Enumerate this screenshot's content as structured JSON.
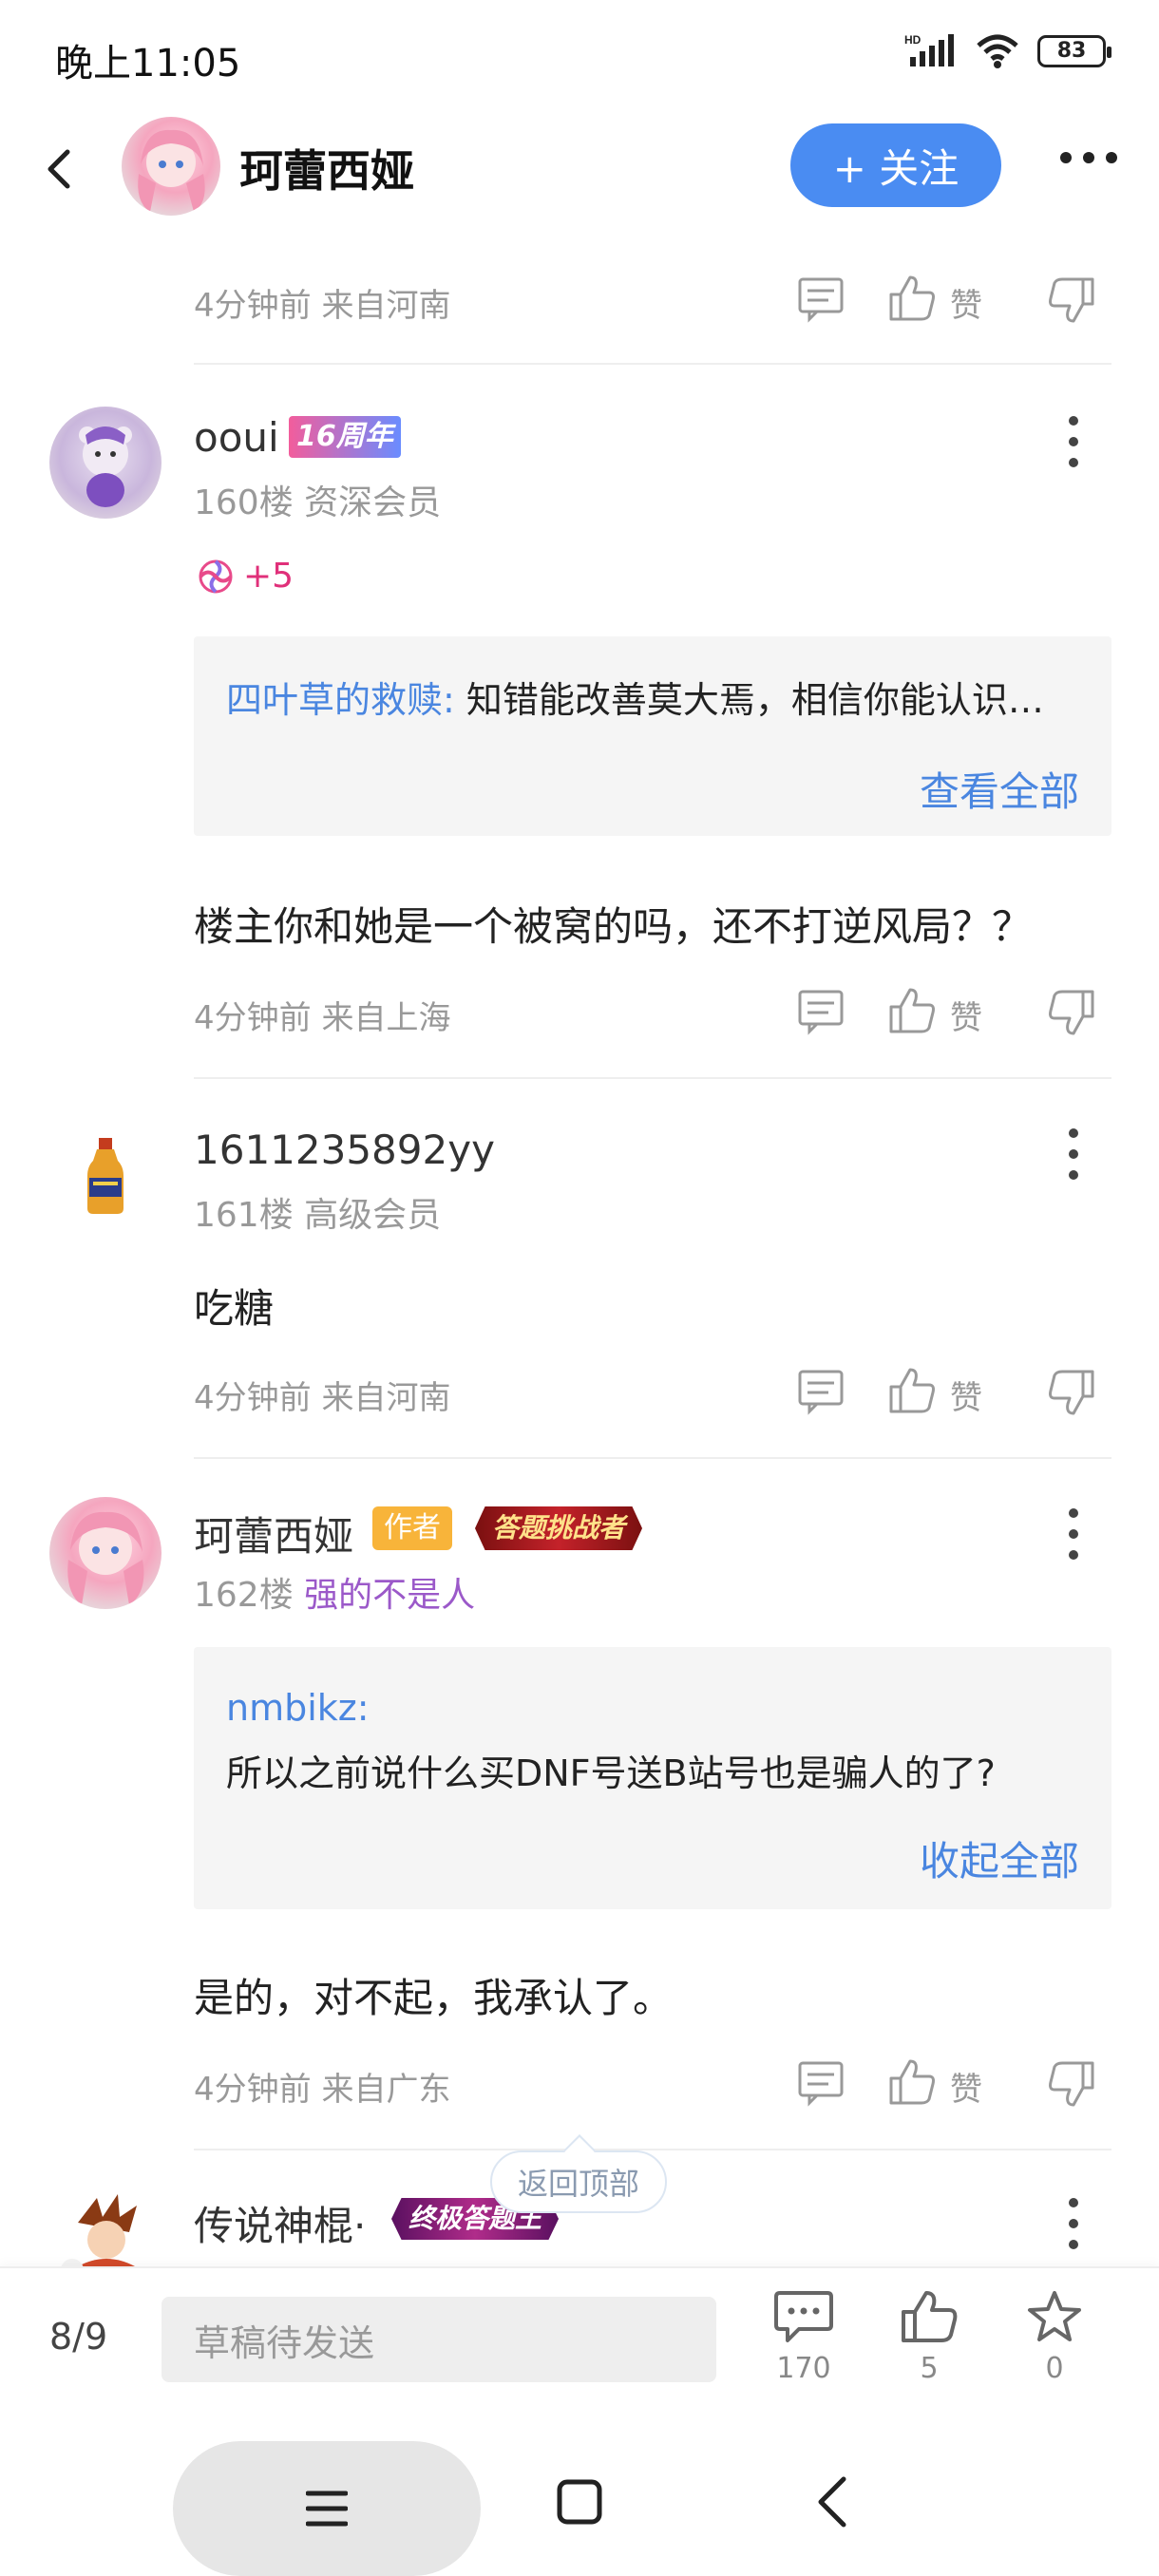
{
  "status_bar": {
    "time": "晚上11:05",
    "network": "HD",
    "battery": "83"
  },
  "header": {
    "title": "珂蕾西娅",
    "follow_label": "+ 关注"
  },
  "floors": [
    {
      "meta": "4分钟前 来自河南",
      "like_label": "赞"
    },
    {
      "username": "ooui",
      "badge": "16周年",
      "floor_info": "160楼 资深会员",
      "gift_count": "+5",
      "quote_user": "四叶草的救赎:",
      "quote_text": " 知错能改善莫大焉，相信你能认识…",
      "quote_link": "查看全部",
      "content": "楼主你和她是一个被窝的吗，还不打逆风局？？",
      "meta": "4分钟前 来自上海",
      "like_label": "赞"
    },
    {
      "username": "1611235892yy",
      "floor_info": "161楼 高级会员",
      "content": "吃糖",
      "meta": "4分钟前 来自河南",
      "like_label": "赞"
    },
    {
      "username": "珂蕾西娅",
      "badge_author": "作者",
      "badge_challenge": "答题挑战者",
      "floor_number": "162楼",
      "floor_title": "强的不是人",
      "quote_user": "nmbikz:",
      "quote_text": "所以之前说什么买DNF号送B站号也是骗人的了?",
      "quote_link": "收起全部",
      "content": "是的，对不起，我承认了。",
      "meta": "4分钟前 来自广东",
      "like_label": "赞"
    },
    {
      "username": "传说神棍·",
      "badge_ultimate": "终极答题王"
    }
  ],
  "back_to_top": "返回顶部",
  "bottom_bar": {
    "page": "8/9",
    "draft_placeholder": "草稿待发送",
    "comments": "170",
    "likes": "5",
    "favorites": "0"
  },
  "colors": {
    "accent": "#4a8cf2",
    "link": "#4a86e0",
    "purple_title": "#9b59c9"
  }
}
